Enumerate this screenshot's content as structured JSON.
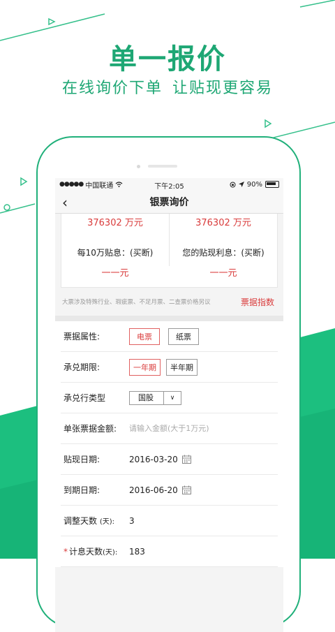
{
  "hero": {
    "title": "单一报价",
    "subtitle_part1": "在线询价下单",
    "subtitle_part2": "让贴现更容易"
  },
  "status_bar": {
    "carrier": "中国联通",
    "time": "下午2:05",
    "battery": "90%"
  },
  "nav": {
    "title": "银票询价"
  },
  "summary": {
    "amount_left": "376302 万元",
    "amount_right": "376302 万元",
    "per_100k_label": "每10万贴息：(买断)",
    "per_100k_value": "一一元",
    "your_interest_label": "您的贴现利息：(买断)",
    "your_interest_value": "一一元",
    "note": "大票涉及特殊行业、瑕疵票、不足月票、二查票价格另议",
    "index_link": "票据指数"
  },
  "form": {
    "bill_attr_label": "票据属性:",
    "bill_attr_options": [
      "电票",
      "纸票"
    ],
    "term_label": "承兑期限:",
    "term_options": [
      "一年期",
      "半年期"
    ],
    "bank_type_label": "承兑行类型",
    "bank_type_value": "国股",
    "amount_label": "单张票据金额:",
    "amount_placeholder": "请输入金额(大于1万元)",
    "discount_date_label": "贴现日期:",
    "discount_date_value": "2016-03-20",
    "due_date_label": "到期日期:",
    "due_date_value": "2016-06-20",
    "adjust_days_label": "调整天数",
    "adjust_days_unit": "(天):",
    "adjust_days_value": "3",
    "interest_days_label": "计息天数",
    "interest_days_unit": "(天):",
    "interest_days_value": "183"
  },
  "colors": {
    "brand_green": "#1ea774",
    "accent_red": "#d93b3b"
  }
}
